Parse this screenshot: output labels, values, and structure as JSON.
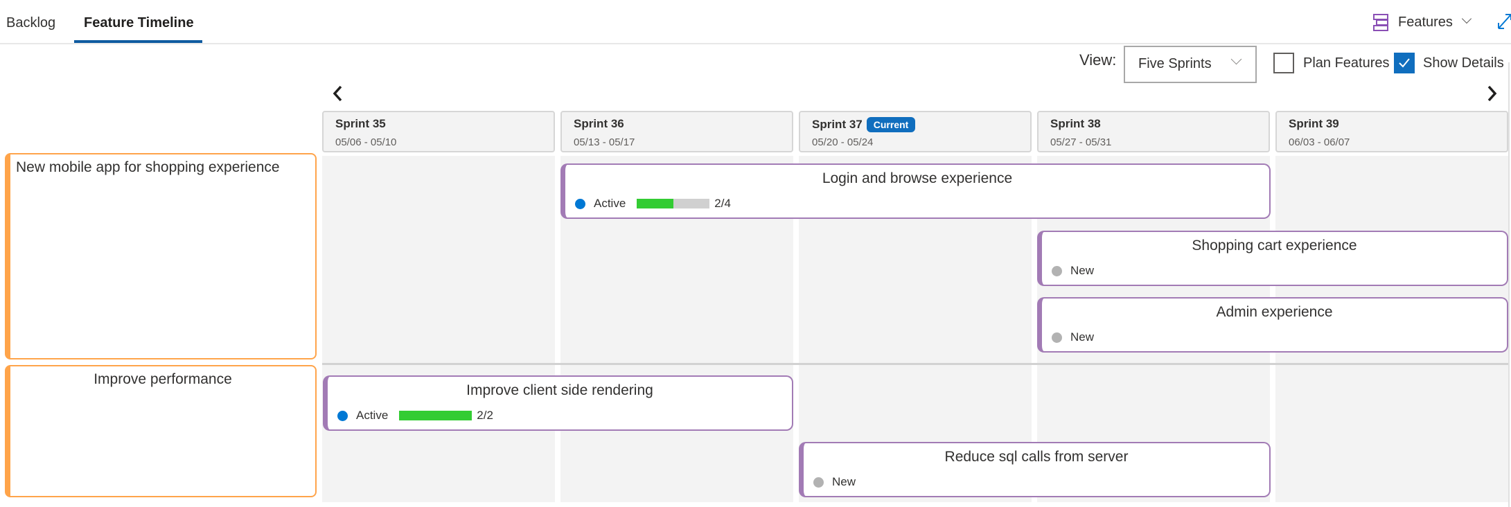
{
  "tabs": [
    {
      "label": "Backlog",
      "active": false
    },
    {
      "label": "Feature Timeline",
      "active": true
    }
  ],
  "header": {
    "features_selector": {
      "label": "Features",
      "icon": "features-list-icon"
    },
    "expand_icon": "expand-icon"
  },
  "toolbar": {
    "view_label": "View:",
    "view_selected": "Five Sprints",
    "plan_features": {
      "label": "Plan Features",
      "checked": false
    },
    "show_details": {
      "label": "Show Details",
      "checked": true
    }
  },
  "nav": {
    "prev_icon": "chevron-left-icon",
    "next_icon": "chevron-right-icon"
  },
  "sprints": [
    {
      "name": "Sprint 35",
      "dates": "05/06 - 05/10",
      "current": false
    },
    {
      "name": "Sprint 36",
      "dates": "05/13 - 05/17",
      "current": false
    },
    {
      "name": "Sprint 37",
      "dates": "05/20 - 05/24",
      "current": true,
      "badge": "Current"
    },
    {
      "name": "Sprint 38",
      "dates": "05/27 - 05/31",
      "current": false
    },
    {
      "name": "Sprint 39",
      "dates": "06/03 - 06/07",
      "current": false
    }
  ],
  "colors": {
    "epic": "#ffa44a",
    "feature": "#a27bb5",
    "active_state": "#0078d4",
    "new_state": "#b2b2b2",
    "progress_done": "#33cc33",
    "progress_remaining": "#d0d0d0",
    "accent": "#106ebe"
  },
  "epics": [
    {
      "title": "New mobile app for shopping experience",
      "features": [
        {
          "title": "Login and browse experience",
          "state": "Active",
          "start_sprint": "Sprint 36",
          "end_sprint": "Sprint 38",
          "progress_done": 2,
          "progress_total": 4,
          "progress_text": "2/4"
        },
        {
          "title": "Shopping cart experience",
          "state": "New",
          "start_sprint": "Sprint 38",
          "end_sprint": "Sprint 39"
        },
        {
          "title": "Admin experience",
          "state": "New",
          "start_sprint": "Sprint 38",
          "end_sprint": "Sprint 39"
        }
      ]
    },
    {
      "title": "Improve performance",
      "features": [
        {
          "title": "Improve client side rendering",
          "state": "Active",
          "start_sprint": "Sprint 35",
          "end_sprint": "Sprint 36",
          "progress_done": 2,
          "progress_total": 2,
          "progress_text": "2/2"
        },
        {
          "title": "Reduce sql calls from server",
          "state": "New",
          "start_sprint": "Sprint 37",
          "end_sprint": "Sprint 38"
        }
      ]
    }
  ]
}
